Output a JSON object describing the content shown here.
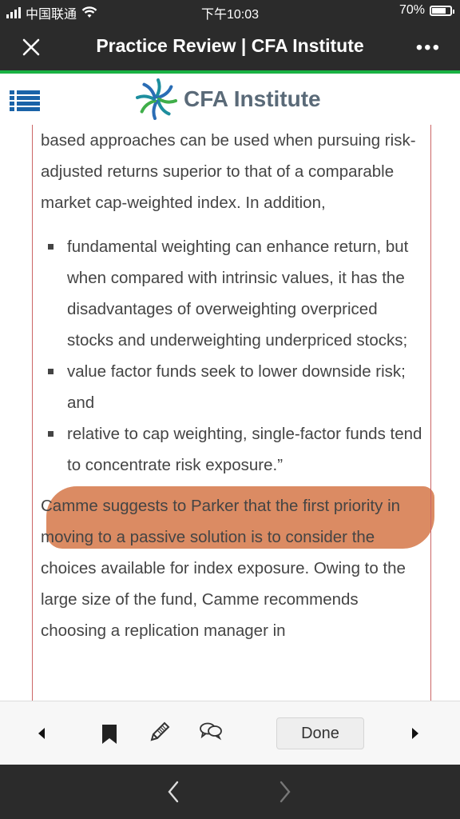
{
  "status_bar": {
    "carrier": "中国联通",
    "time": "下午10:03",
    "battery": "70%",
    "battery_level": 0.7
  },
  "nav": {
    "title": "Practice Review | CFA Institute",
    "close_icon": "close-icon",
    "more_icon": "more-icon",
    "more_label": "•••"
  },
  "site": {
    "logo_text": "CFA Institute",
    "menu_icon": "list-menu-icon"
  },
  "article": {
    "para1": "based approaches can be used when pursuing risk-adjusted returns superior to that of a comparable market cap-weighted index. In addition,",
    "bullets": [
      "fundamental weighting can enhance return, but when compared with intrinsic values, it has the disadvantages of overweighting overpriced stocks and underweighting underpriced stocks;",
      "value factor funds seek to lower downside risk; and",
      "relative to cap weighting, single-factor funds tend to concentrate risk exposure.”"
    ],
    "para2": "Camme suggests to Parker that the first priority in moving to a passive solution is to consider the choices available for index exposure. Owing to the large size of the fund, Camme recommends choosing a replication manager in"
  },
  "highlight": {
    "color": "#d9855b"
  },
  "toolbar": {
    "done_label": "Done",
    "prev_icon": "triangle-left-icon",
    "bookmark_icon": "bookmark-icon",
    "pencil_icon": "pencil-icon",
    "comment_icon": "comment-bubbles-icon",
    "next_icon": "triangle-right-icon"
  },
  "browser": {
    "back_icon": "chevron-left-icon",
    "forward_icon": "chevron-right-icon"
  }
}
